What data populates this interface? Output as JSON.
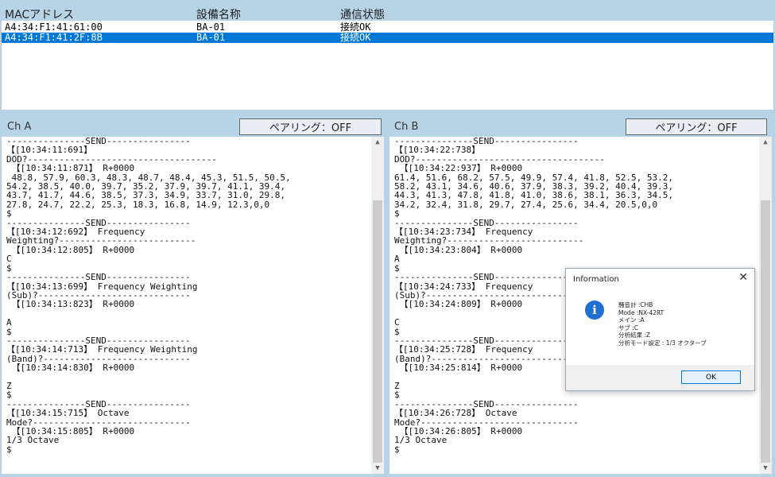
{
  "device_list": {
    "columns": {
      "mac": "MACアドレス",
      "name": "設備名称",
      "status": "通信状態"
    },
    "rows": [
      {
        "mac": "A4:34:F1:41:61:00",
        "name": "BA-01",
        "status": "接続OK",
        "selected": false
      },
      {
        "mac": "A4:34:F1:41:2F:8B",
        "name": "BA-01",
        "status": "接続OK",
        "selected": true
      }
    ]
  },
  "channel_a": {
    "label": "Ch A",
    "pairing_button": "ペアリング：OFF",
    "log": "---------------SEND----------------\n【[10:34:11:691】\nDOD?------------------------------------\n 【[10:34:11:871】 R+0000\n 48.8, 57.9, 60.3, 48.3, 48.7, 48.4, 45.3, 51.5, 50.5,\n54.2, 38.5, 40.0, 39.7, 35.2, 37.9, 39.7, 41.1, 39.4,\n43.7, 41.7, 44.6, 38.5, 37.3, 34.9, 33.7, 31.0, 29.8,\n27.8, 24.7, 22.2, 25.3, 18.3, 16.8, 14.9, 12.3,0,0\n$\n---------------SEND----------------\n【[10:34:12:692】 Frequency\nWeighting?--------------------------\n 【[10:34:12:805】 R+0000\nC\n$\n---------------SEND----------------\n【[10:34:13:699】 Frequency Weighting\n(Sub)?-----------------------------\n 【[10:34:13:823】 R+0000\n\nA\n$\n---------------SEND----------------\n【[10:34:14:713】 Frequency Weighting\n(Band)?----------------------------\n 【[10:34:14:830】 R+0000\n\nZ\n$\n---------------SEND----------------\n【[10:34:15:715】 Octave\nMode?------------------------------\n 【[10:34:15:805】 R+0000\n1/3 Octave\n$"
  },
  "channel_b": {
    "label": "Ch B",
    "pairing_button": "ペアリング：OFF",
    "log": "---------------SEND----------------\n【[10:34:22:738】\nDOD?------------------------------------\n 【[10:34:22:937】 R+0000\n61.4, 51.6, 68.2, 57.5, 49.9, 57.4, 41.8, 52.5, 53.2,\n58.2, 43.1, 34.6, 40.6, 37.9, 38.3, 39.2, 40.4, 39.3,\n44.3, 41.3, 47.8, 41.8, 41.0, 38.6, 38.1, 36.3, 34.5,\n34.2, 32.4, 31.8, 29.7, 27.4, 25.6, 34.4, 20.5,0,0\n$\n---------------SEND----------------\n【[10:34:23:734】 Frequency\nWeighting?--------------------------\n 【[10:34:23:804】 R+0000\nA\n$\n---------------SEND----------------\n【[10:34:24:733】 Frequency\n(Sub)?-----------------------------\n 【[10:34:24:809】 R+0000\n\nC\n$\n---------------SEND----------------\n【[10:34:25:728】 Frequency\n(Band)?----------------------------\n 【[10:34:25:814】 R+0000\n\nZ\n$\n---------------SEND----------------\n【[10:34:26:728】 Octave\nMode?------------------------------\n 【[10:34:26:805】 R+0000\n1/3 Octave\n$"
  },
  "info_dialog": {
    "title": "Information",
    "close": "✕",
    "icon": "info-icon",
    "icon_glyph": "i",
    "lines": [
      "騒音計 :CHB",
      "Mode :NX-42RT",
      "メイン :A",
      "サブ :C",
      "分析結果 :Z",
      "分析モード設定 : 1/3 オクターブ"
    ],
    "ok_label": "OK"
  }
}
